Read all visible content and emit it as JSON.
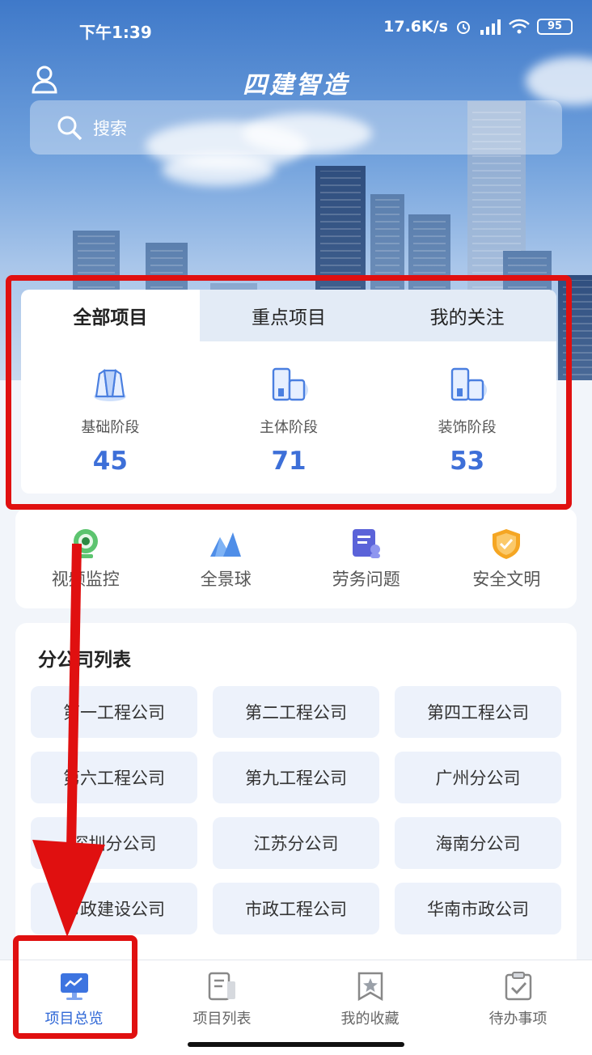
{
  "status_bar": {
    "time": "下午1:39",
    "network_speed": "17.6K/s",
    "battery": "95"
  },
  "header": {
    "title": "四建智造"
  },
  "search": {
    "placeholder": "搜索"
  },
  "tabs": [
    {
      "label": "全部项目",
      "active": true
    },
    {
      "label": "重点项目",
      "active": false
    },
    {
      "label": "我的关注",
      "active": false
    }
  ],
  "stages": [
    {
      "label": "基础阶段",
      "count": "45",
      "icon": "foundation-icon"
    },
    {
      "label": "主体阶段",
      "count": "71",
      "icon": "building-icon"
    },
    {
      "label": "装饰阶段",
      "count": "53",
      "icon": "decoration-icon"
    }
  ],
  "quick_actions": [
    {
      "label": "视频监控",
      "icon": "camera-icon"
    },
    {
      "label": "全景球",
      "icon": "panorama-icon"
    },
    {
      "label": "劳务问题",
      "icon": "labor-icon"
    },
    {
      "label": "安全文明",
      "icon": "shield-icon"
    }
  ],
  "branches": {
    "title": "分公司列表",
    "items": [
      "第一工程公司",
      "第二工程公司",
      "第四工程公司",
      "第六工程公司",
      "第九工程公司",
      "广州分公司",
      "深圳分公司",
      "江苏分公司",
      "海南分公司",
      "市政建设公司",
      "市政工程公司",
      "华南市政公司"
    ]
  },
  "bottom_nav": [
    {
      "label": "项目总览",
      "active": true,
      "icon": "monitor-chart-icon"
    },
    {
      "label": "项目列表",
      "active": false,
      "icon": "list-doc-icon"
    },
    {
      "label": "我的收藏",
      "active": false,
      "icon": "bookmark-star-icon"
    },
    {
      "label": "待办事项",
      "active": false,
      "icon": "clipboard-check-icon"
    }
  ],
  "colors": {
    "accent": "#3d6fd8",
    "highlight": "#e01010",
    "tab_inactive": "#e1eaf6"
  }
}
